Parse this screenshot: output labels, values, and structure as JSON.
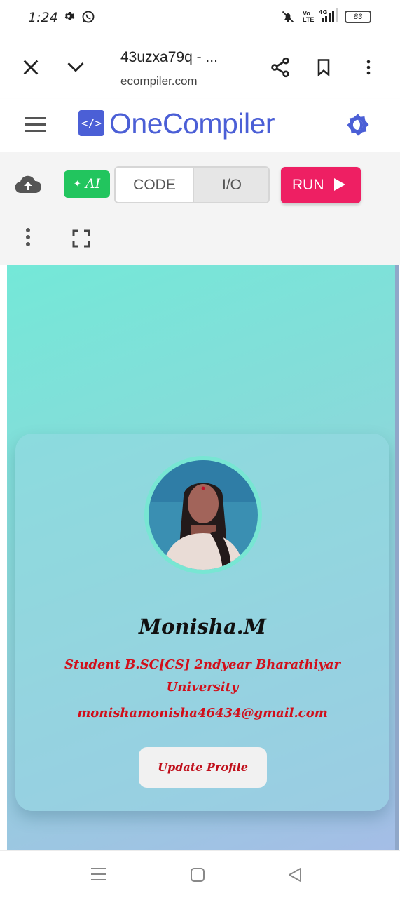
{
  "status_bar": {
    "time": "1:24",
    "battery": "83",
    "network": "4G",
    "volte": "Vo LTE"
  },
  "browser": {
    "page_title": "43uzxa79q - ...",
    "domain": "ecompiler.com"
  },
  "app": {
    "brand": "OneCompiler",
    "logo_text": "</>"
  },
  "toolbar": {
    "ai_label": "AI",
    "tabs": [
      {
        "label": "CODE"
      },
      {
        "label": "I/O"
      }
    ],
    "run_label": "RUN"
  },
  "profile": {
    "name": "Monisha.M",
    "bio": "Student B.SC[CS] 2ndyear Bharathiyar University",
    "email": "monishamonisha46434@gmail.com",
    "button_label": "Update Profile"
  },
  "colors": {
    "brand": "#4b5fd6",
    "run": "#ee1f63",
    "ai": "#22c55e",
    "accent_text": "#d10f1a"
  }
}
